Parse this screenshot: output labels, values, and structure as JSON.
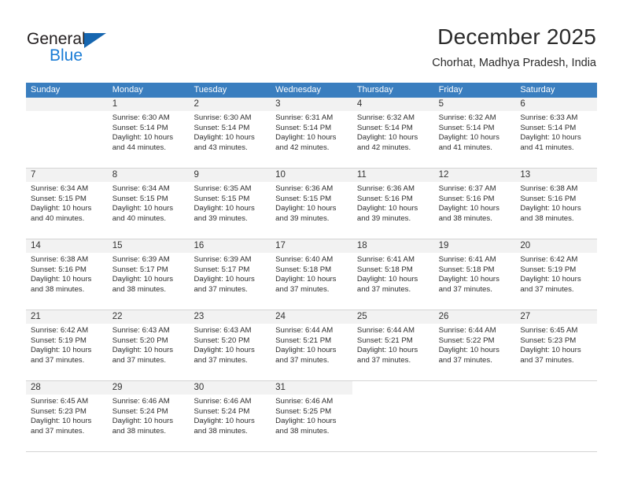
{
  "logo": {
    "text_primary": "General",
    "text_secondary": "Blue",
    "primary_color": "#231f20",
    "secondary_color": "#1a7cd5",
    "triangle_color": "#1666b0"
  },
  "header": {
    "title": "December 2025",
    "subtitle": "Chorhat, Madhya Pradesh, India"
  },
  "theme": {
    "header_row_bg": "#3a7ebf",
    "header_row_text": "#ffffff",
    "day_band_bg": "#f2f2f2",
    "grid_line": "#d4d4d4"
  },
  "weekdays": [
    "Sunday",
    "Monday",
    "Tuesday",
    "Wednesday",
    "Thursday",
    "Friday",
    "Saturday"
  ],
  "weeks": [
    [
      {
        "date": "",
        "lines": []
      },
      {
        "date": "1",
        "lines": [
          "Sunrise: 6:30 AM",
          "Sunset: 5:14 PM",
          "Daylight: 10 hours",
          "and 44 minutes."
        ]
      },
      {
        "date": "2",
        "lines": [
          "Sunrise: 6:30 AM",
          "Sunset: 5:14 PM",
          "Daylight: 10 hours",
          "and 43 minutes."
        ]
      },
      {
        "date": "3",
        "lines": [
          "Sunrise: 6:31 AM",
          "Sunset: 5:14 PM",
          "Daylight: 10 hours",
          "and 42 minutes."
        ]
      },
      {
        "date": "4",
        "lines": [
          "Sunrise: 6:32 AM",
          "Sunset: 5:14 PM",
          "Daylight: 10 hours",
          "and 42 minutes."
        ]
      },
      {
        "date": "5",
        "lines": [
          "Sunrise: 6:32 AM",
          "Sunset: 5:14 PM",
          "Daylight: 10 hours",
          "and 41 minutes."
        ]
      },
      {
        "date": "6",
        "lines": [
          "Sunrise: 6:33 AM",
          "Sunset: 5:14 PM",
          "Daylight: 10 hours",
          "and 41 minutes."
        ]
      }
    ],
    [
      {
        "date": "7",
        "lines": [
          "Sunrise: 6:34 AM",
          "Sunset: 5:15 PM",
          "Daylight: 10 hours",
          "and 40 minutes."
        ]
      },
      {
        "date": "8",
        "lines": [
          "Sunrise: 6:34 AM",
          "Sunset: 5:15 PM",
          "Daylight: 10 hours",
          "and 40 minutes."
        ]
      },
      {
        "date": "9",
        "lines": [
          "Sunrise: 6:35 AM",
          "Sunset: 5:15 PM",
          "Daylight: 10 hours",
          "and 39 minutes."
        ]
      },
      {
        "date": "10",
        "lines": [
          "Sunrise: 6:36 AM",
          "Sunset: 5:15 PM",
          "Daylight: 10 hours",
          "and 39 minutes."
        ]
      },
      {
        "date": "11",
        "lines": [
          "Sunrise: 6:36 AM",
          "Sunset: 5:16 PM",
          "Daylight: 10 hours",
          "and 39 minutes."
        ]
      },
      {
        "date": "12",
        "lines": [
          "Sunrise: 6:37 AM",
          "Sunset: 5:16 PM",
          "Daylight: 10 hours",
          "and 38 minutes."
        ]
      },
      {
        "date": "13",
        "lines": [
          "Sunrise: 6:38 AM",
          "Sunset: 5:16 PM",
          "Daylight: 10 hours",
          "and 38 minutes."
        ]
      }
    ],
    [
      {
        "date": "14",
        "lines": [
          "Sunrise: 6:38 AM",
          "Sunset: 5:16 PM",
          "Daylight: 10 hours",
          "and 38 minutes."
        ]
      },
      {
        "date": "15",
        "lines": [
          "Sunrise: 6:39 AM",
          "Sunset: 5:17 PM",
          "Daylight: 10 hours",
          "and 38 minutes."
        ]
      },
      {
        "date": "16",
        "lines": [
          "Sunrise: 6:39 AM",
          "Sunset: 5:17 PM",
          "Daylight: 10 hours",
          "and 37 minutes."
        ]
      },
      {
        "date": "17",
        "lines": [
          "Sunrise: 6:40 AM",
          "Sunset: 5:18 PM",
          "Daylight: 10 hours",
          "and 37 minutes."
        ]
      },
      {
        "date": "18",
        "lines": [
          "Sunrise: 6:41 AM",
          "Sunset: 5:18 PM",
          "Daylight: 10 hours",
          "and 37 minutes."
        ]
      },
      {
        "date": "19",
        "lines": [
          "Sunrise: 6:41 AM",
          "Sunset: 5:18 PM",
          "Daylight: 10 hours",
          "and 37 minutes."
        ]
      },
      {
        "date": "20",
        "lines": [
          "Sunrise: 6:42 AM",
          "Sunset: 5:19 PM",
          "Daylight: 10 hours",
          "and 37 minutes."
        ]
      }
    ],
    [
      {
        "date": "21",
        "lines": [
          "Sunrise: 6:42 AM",
          "Sunset: 5:19 PM",
          "Daylight: 10 hours",
          "and 37 minutes."
        ]
      },
      {
        "date": "22",
        "lines": [
          "Sunrise: 6:43 AM",
          "Sunset: 5:20 PM",
          "Daylight: 10 hours",
          "and 37 minutes."
        ]
      },
      {
        "date": "23",
        "lines": [
          "Sunrise: 6:43 AM",
          "Sunset: 5:20 PM",
          "Daylight: 10 hours",
          "and 37 minutes."
        ]
      },
      {
        "date": "24",
        "lines": [
          "Sunrise: 6:44 AM",
          "Sunset: 5:21 PM",
          "Daylight: 10 hours",
          "and 37 minutes."
        ]
      },
      {
        "date": "25",
        "lines": [
          "Sunrise: 6:44 AM",
          "Sunset: 5:21 PM",
          "Daylight: 10 hours",
          "and 37 minutes."
        ]
      },
      {
        "date": "26",
        "lines": [
          "Sunrise: 6:44 AM",
          "Sunset: 5:22 PM",
          "Daylight: 10 hours",
          "and 37 minutes."
        ]
      },
      {
        "date": "27",
        "lines": [
          "Sunrise: 6:45 AM",
          "Sunset: 5:23 PM",
          "Daylight: 10 hours",
          "and 37 minutes."
        ]
      }
    ],
    [
      {
        "date": "28",
        "lines": [
          "Sunrise: 6:45 AM",
          "Sunset: 5:23 PM",
          "Daylight: 10 hours",
          "and 37 minutes."
        ]
      },
      {
        "date": "29",
        "lines": [
          "Sunrise: 6:46 AM",
          "Sunset: 5:24 PM",
          "Daylight: 10 hours",
          "and 38 minutes."
        ]
      },
      {
        "date": "30",
        "lines": [
          "Sunrise: 6:46 AM",
          "Sunset: 5:24 PM",
          "Daylight: 10 hours",
          "and 38 minutes."
        ]
      },
      {
        "date": "31",
        "lines": [
          "Sunrise: 6:46 AM",
          "Sunset: 5:25 PM",
          "Daylight: 10 hours",
          "and 38 minutes."
        ]
      },
      {
        "date": "",
        "lines": []
      },
      {
        "date": "",
        "lines": []
      },
      {
        "date": "",
        "lines": []
      }
    ]
  ]
}
